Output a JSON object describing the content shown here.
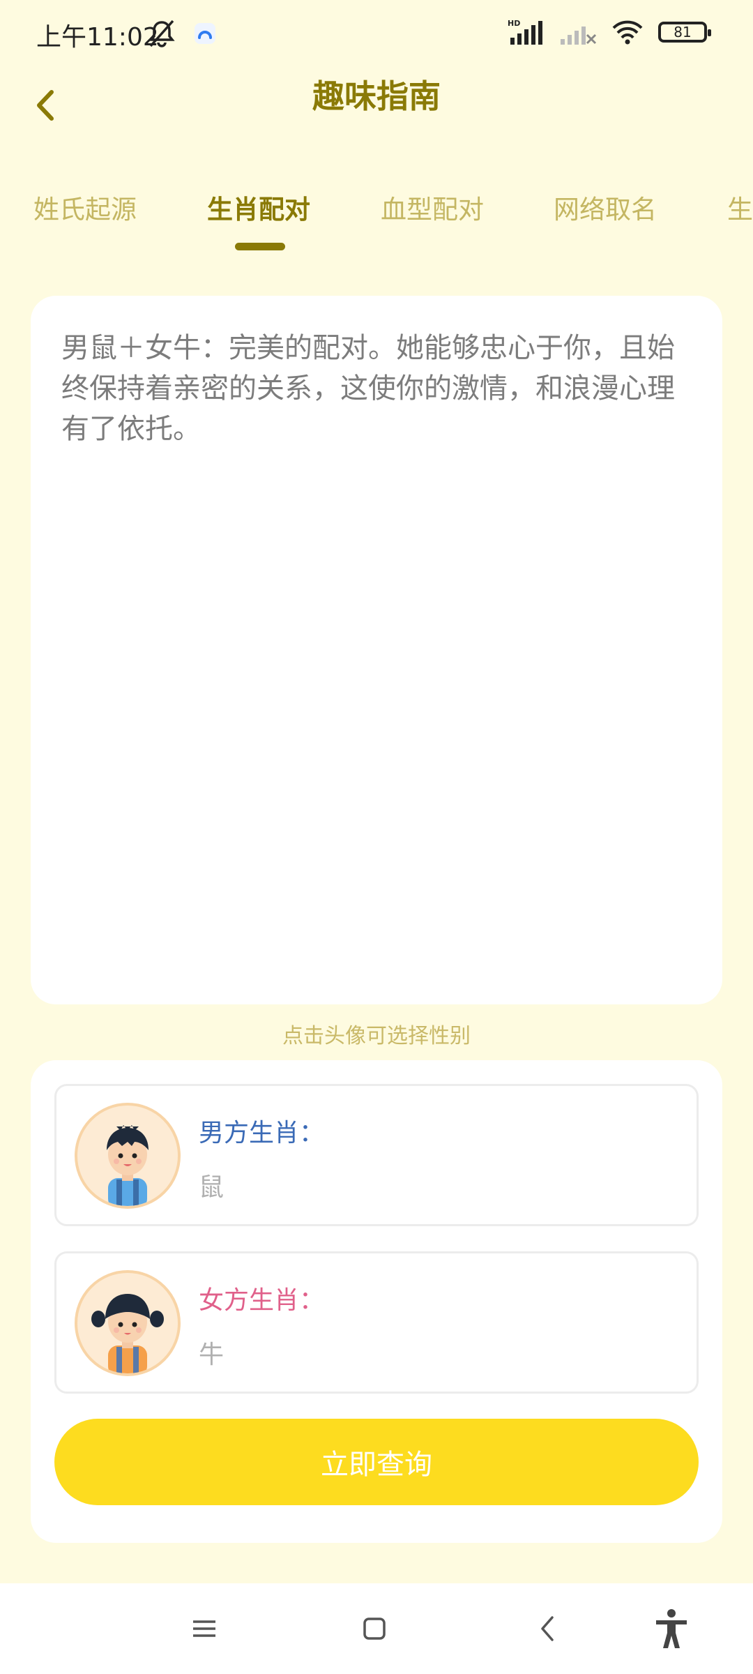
{
  "status_bar": {
    "time": "上午11:02",
    "battery": "81",
    "network_label": "HD"
  },
  "header": {
    "title": "趣味指南",
    "back_icon": "chevron-left-icon"
  },
  "tabs": [
    {
      "label": "姓氏起源",
      "active": false
    },
    {
      "label": "生肖配对",
      "active": true
    },
    {
      "label": "血型配对",
      "active": false
    },
    {
      "label": "网络取名",
      "active": false
    },
    {
      "label": "生",
      "active": false
    }
  ],
  "result": {
    "text": "男鼠＋女牛：完美的配对。她能够忠心于你，且始终保持着亲密的关系，这使你的激情，和浪漫心理有了依托。"
  },
  "hint": "点击头像可选择性别",
  "query": {
    "male_label": "男方生肖：",
    "male_value": "鼠",
    "female_label": "女方生肖：",
    "female_value": "牛",
    "button_label": "立即查询"
  },
  "colors": {
    "background": "#fefbe0",
    "accent": "#8a7a06",
    "tab_inactive": "#c4b662",
    "button": "#fddc1f",
    "male_label": "#3a6ab6",
    "female_label": "#e0608a"
  },
  "nav_icons": [
    "menu-icon",
    "home-icon",
    "back-icon",
    "accessibility-icon"
  ]
}
